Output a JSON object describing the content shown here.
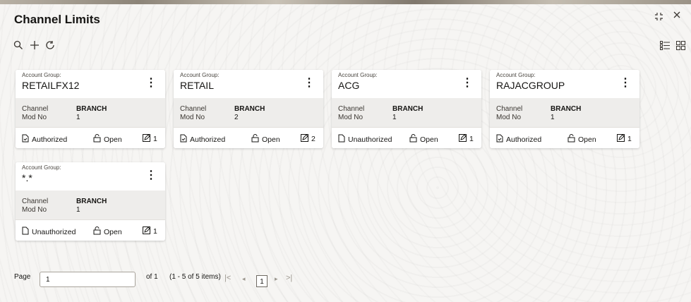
{
  "page": {
    "title": "Channel Limits"
  },
  "toolbar": {
    "icons": [
      "search-icon",
      "add-icon",
      "refresh-icon"
    ]
  },
  "view_toggle": [
    "list-view-icon",
    "tile-view-icon"
  ],
  "cards": [
    {
      "group_label": "Account Group:",
      "group": "RETAILFX12",
      "channel_label": "Channel",
      "channel": "BRANCH",
      "mod_label": "Mod No",
      "mod": "1",
      "auth": "Authorized",
      "status": "Open",
      "edits": "1"
    },
    {
      "group_label": "Account Group:",
      "group": "RETAIL",
      "channel_label": "Channel",
      "channel": "BRANCH",
      "mod_label": "Mod No",
      "mod": "2",
      "auth": "Authorized",
      "status": "Open",
      "edits": "2"
    },
    {
      "group_label": "Account Group:",
      "group": "ACG",
      "channel_label": "Channel",
      "channel": "BRANCH",
      "mod_label": "Mod No",
      "mod": "1",
      "auth": "Unauthorized",
      "status": "Open",
      "edits": "1"
    },
    {
      "group_label": "Account Group:",
      "group": "RAJACGROUP",
      "channel_label": "Channel",
      "channel": "BRANCH",
      "mod_label": "Mod No",
      "mod": "1",
      "auth": "Authorized",
      "status": "Open",
      "edits": "1"
    },
    {
      "group_label": "Account Group:",
      "group": "*.*",
      "channel_label": "Channel",
      "channel": "BRANCH",
      "mod_label": "Mod No",
      "mod": "1",
      "auth": "Unauthorized",
      "status": "Open",
      "edits": "1"
    }
  ],
  "pagination": {
    "page_label": "Page",
    "page_value": "1",
    "of_text": "of 1",
    "range_text": "(1 - 5 of 5 items)",
    "current": "1"
  }
}
